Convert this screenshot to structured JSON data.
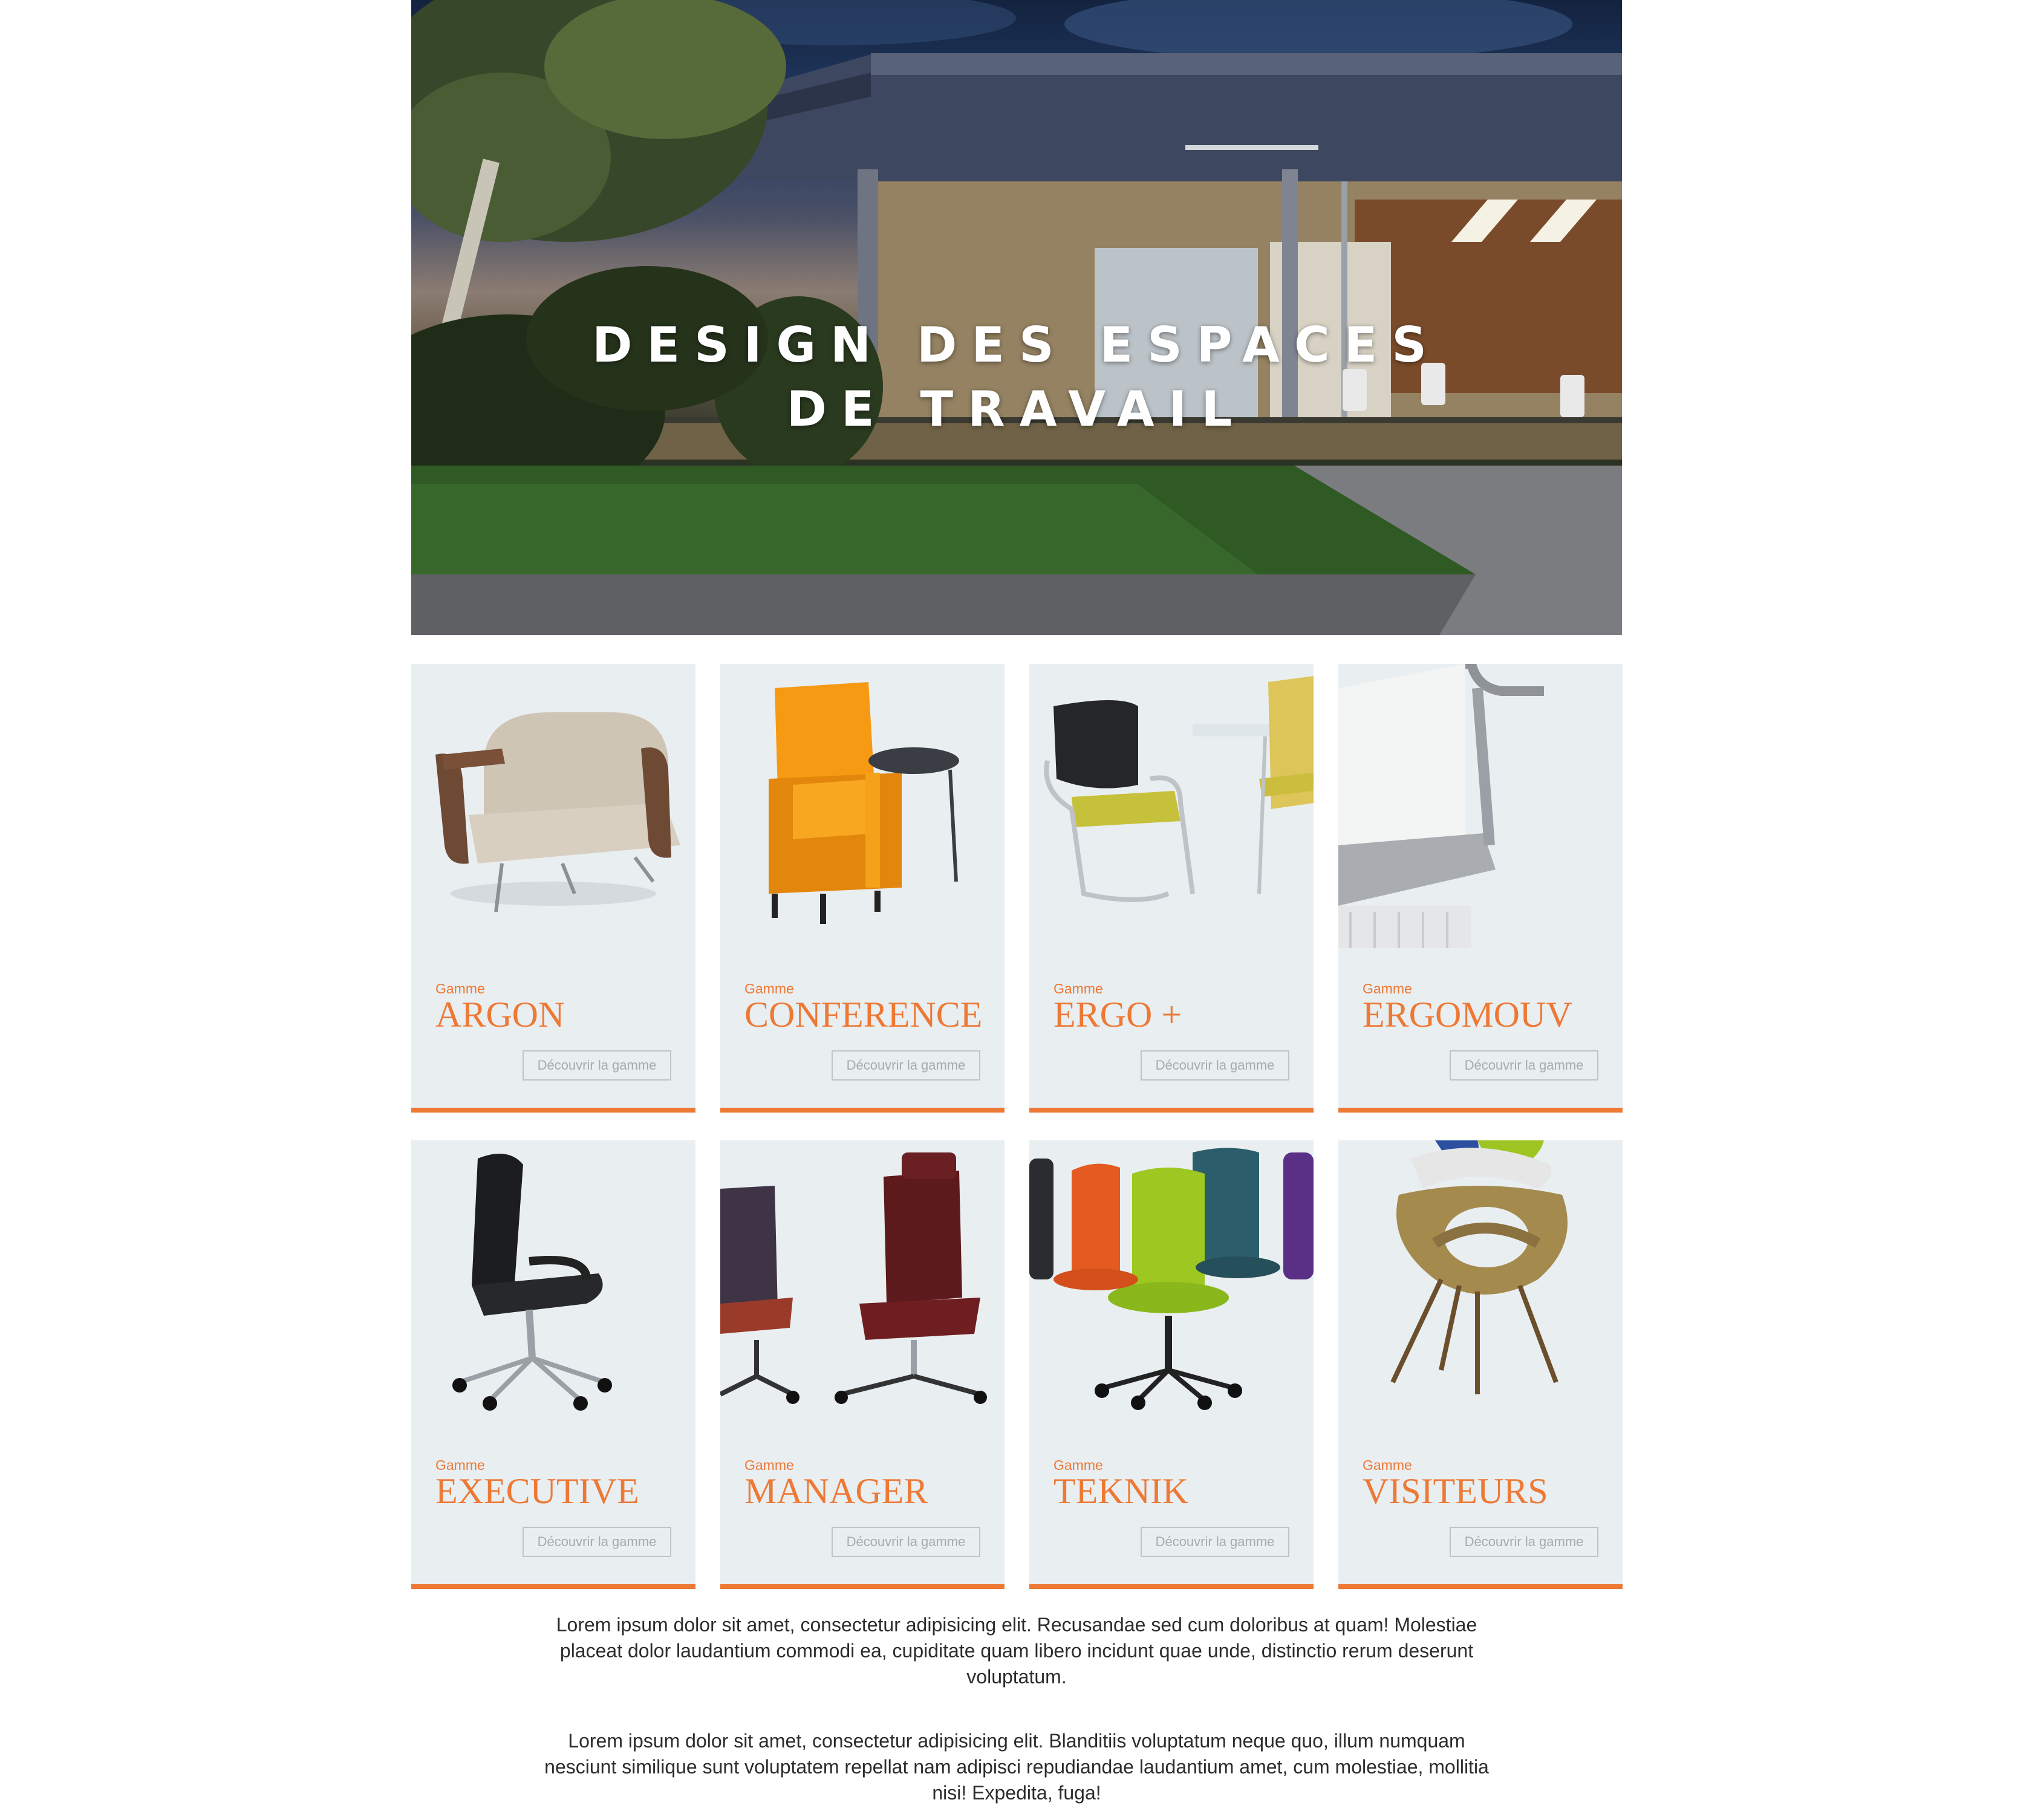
{
  "hero": {
    "title_line1": "DESIGN DES ESPACES",
    "title_line2": "DE TRAVAIL"
  },
  "cards": [
    {
      "kicker": "Gamme",
      "name": "ARGON",
      "button": "Découvrir la gamme"
    },
    {
      "kicker": "Gamme",
      "name": "CONFERENCE",
      "button": "Découvrir la gamme"
    },
    {
      "kicker": "Gamme",
      "name": "ERGO +",
      "button": "Découvrir la gamme"
    },
    {
      "kicker": "Gamme",
      "name": "ERGOMOUV",
      "button": "Découvrir la gamme"
    },
    {
      "kicker": "Gamme",
      "name": "EXECUTIVE",
      "button": "Découvrir la gamme"
    },
    {
      "kicker": "Gamme",
      "name": "MANAGER",
      "button": "Découvrir la gamme"
    },
    {
      "kicker": "Gamme",
      "name": "TEKNIK",
      "button": "Découvrir la gamme"
    },
    {
      "kicker": "Gamme",
      "name": "VISITEURS",
      "button": "Découvrir la gamme"
    }
  ],
  "paragraphs": [
    "Lorem ipsum dolor sit amet, consectetur adipisicing elit. Recusandae sed cum doloribus at quam! Molestiae placeat dolor laudantium commodi ea, cupiditate quam libero incidunt quae unde, distinctio rerum deserunt voluptatum.",
    "Lorem ipsum dolor sit amet, consectetur adipisicing elit. Blanditiis voluptatum neque quo, illum numquam nesciunt similique sunt voluptatem repellat nam adipisci repudiandae laudantium amet, cum molestiae, mollitia nisi! Expedita, fuga!"
  ],
  "colors": {
    "accent": "#ed7935",
    "card_background": "#e9eef1",
    "button_border": "#bfc4c7",
    "body_text": "#2c2c2c"
  },
  "images": {
    "hero": "modern-office-building-at-dusk",
    "card_images": [
      "armchair-icon",
      "orange-conference-chair-icon",
      "mesh-visitor-chair-icon",
      "ergonomic-chair-closeup-icon",
      "executive-chair-icon",
      "manager-chairs-icon",
      "colorful-task-chairs-icon",
      "shell-visitor-chair-icon"
    ]
  }
}
